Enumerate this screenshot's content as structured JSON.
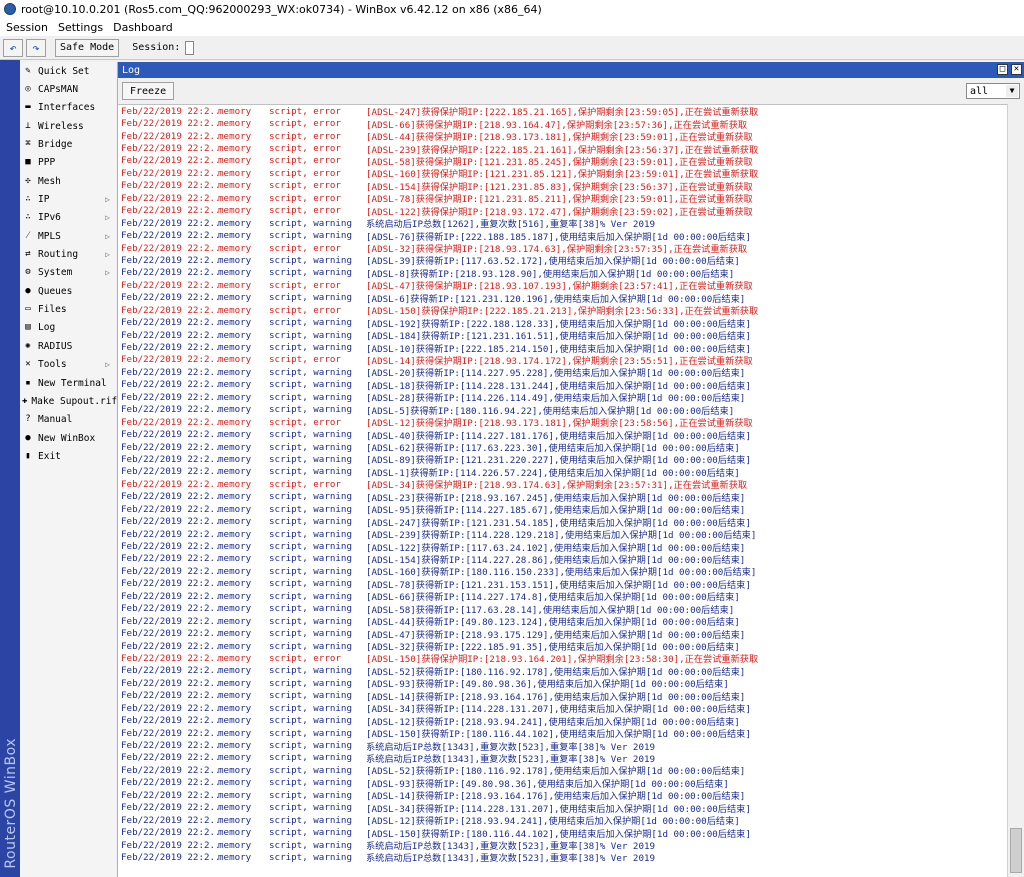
{
  "window": {
    "title": "root@10.10.0.201 (Ros5.com_QQ:962000293_WX:ok0734) - WinBox v6.42.12 on x86 (x86_64)"
  },
  "menu": [
    "Session",
    "Settings",
    "Dashboard"
  ],
  "toolbar": {
    "undo": "↶",
    "redo": "↷",
    "safe_mode": "Safe Mode",
    "session_label": "Session:"
  },
  "brand": "RouterOS WinBox",
  "sidebar": [
    {
      "label": "Quick Set",
      "icon": "quick-set-icon",
      "glyph": "✎",
      "arrow": false
    },
    {
      "label": "CAPsMAN",
      "icon": "capsman-icon",
      "glyph": "◎",
      "arrow": false
    },
    {
      "label": "Interfaces",
      "icon": "interfaces-icon",
      "glyph": "▬",
      "arrow": false
    },
    {
      "label": "Wireless",
      "icon": "wireless-icon",
      "glyph": "⊥",
      "arrow": false
    },
    {
      "label": "Bridge",
      "icon": "bridge-icon",
      "glyph": "⌘",
      "arrow": false
    },
    {
      "label": "PPP",
      "icon": "ppp-icon",
      "glyph": "■",
      "arrow": false
    },
    {
      "label": "Mesh",
      "icon": "mesh-icon",
      "glyph": "✣",
      "arrow": false
    },
    {
      "label": "IP",
      "icon": "ip-icon",
      "glyph": "∴",
      "arrow": true
    },
    {
      "label": "IPv6",
      "icon": "ipv6-icon",
      "glyph": "∴",
      "arrow": true
    },
    {
      "label": "MPLS",
      "icon": "mpls-icon",
      "glyph": "⁄",
      "arrow": true
    },
    {
      "label": "Routing",
      "icon": "routing-icon",
      "glyph": "⇄",
      "arrow": true
    },
    {
      "label": "System",
      "icon": "system-icon",
      "glyph": "⚙",
      "arrow": true
    },
    {
      "label": "Queues",
      "icon": "queues-icon",
      "glyph": "●",
      "arrow": false
    },
    {
      "label": "Files",
      "icon": "files-icon",
      "glyph": "▭",
      "arrow": false
    },
    {
      "label": "Log",
      "icon": "log-icon",
      "glyph": "▤",
      "arrow": false
    },
    {
      "label": "RADIUS",
      "icon": "radius-icon",
      "glyph": "✺",
      "arrow": false
    },
    {
      "label": "Tools",
      "icon": "tools-icon",
      "glyph": "✕",
      "arrow": true
    },
    {
      "label": "New Terminal",
      "icon": "terminal-icon",
      "glyph": "▪",
      "arrow": false
    },
    {
      "label": "Make Supout.rif",
      "icon": "supout-icon",
      "glyph": "✚",
      "arrow": false
    },
    {
      "label": "Manual",
      "icon": "manual-icon",
      "glyph": "?",
      "arrow": false
    },
    {
      "label": "New WinBox",
      "icon": "winbox-icon",
      "glyph": "●",
      "arrow": false
    },
    {
      "label": "Exit",
      "icon": "exit-icon",
      "glyph": "▮",
      "arrow": false
    }
  ],
  "log_window": {
    "title": "Log",
    "freeze_label": "Freeze",
    "filter_value": "all",
    "restore_btn": "□",
    "close_btn": "✕"
  },
  "log": [
    {
      "time": "Feb/22/2019 22:2...",
      "buffer": "memory",
      "topics": "script, error",
      "message": "[ADSL-247]获得保护期IP:[222.185.21.165],保护期剩余[23:59:05],正在尝试重新获取"
    },
    {
      "time": "Feb/22/2019 22:2...",
      "buffer": "memory",
      "topics": "script, error",
      "message": "[ADSL-66]获得保护期IP:[218.93.164.47],保护期剩余[23:57:36],正在尝试重新获取"
    },
    {
      "time": "Feb/22/2019 22:2...",
      "buffer": "memory",
      "topics": "script, error",
      "message": "[ADSL-44]获得保护期IP:[218.93.173.181],保护期剩余[23:59:01],正在尝试重新获取"
    },
    {
      "time": "Feb/22/2019 22:2...",
      "buffer": "memory",
      "topics": "script, error",
      "message": "[ADSL-239]获得保护期IP:[222.185.21.161],保护期剩余[23:56:37],正在尝试重新获取"
    },
    {
      "time": "Feb/22/2019 22:2...",
      "buffer": "memory",
      "topics": "script, error",
      "message": "[ADSL-58]获得保护期IP:[121.231.85.245],保护期剩余[23:59:01],正在尝试重新获取"
    },
    {
      "time": "Feb/22/2019 22:2...",
      "buffer": "memory",
      "topics": "script, error",
      "message": "[ADSL-160]获得保护期IP:[121.231.85.121],保护期剩余[23:59:01],正在尝试重新获取"
    },
    {
      "time": "Feb/22/2019 22:2...",
      "buffer": "memory",
      "topics": "script, error",
      "message": "[ADSL-154]获得保护期IP:[121.231.85.83],保护期剩余[23:56:37],正在尝试重新获取"
    },
    {
      "time": "Feb/22/2019 22:2...",
      "buffer": "memory",
      "topics": "script, error",
      "message": "[ADSL-78]获得保护期IP:[121.231.85.211],保护期剩余[23:59:01],正在尝试重新获取"
    },
    {
      "time": "Feb/22/2019 22:2...",
      "buffer": "memory",
      "topics": "script, error",
      "message": "[ADSL-122]获得保护期IP:[218.93.172.47],保护期剩余[23:59:02],正在尝试重新获取"
    },
    {
      "time": "Feb/22/2019 22:2...",
      "buffer": "memory",
      "topics": "script, warning",
      "message": "系统启动后IP总数[1262],重复次数[516],重复率[38]% Ver 2019"
    },
    {
      "time": "Feb/22/2019 22:2...",
      "buffer": "memory",
      "topics": "script, warning",
      "message": "[ADSL-76]获得新IP:[222.188.185.187],使用结束后加入保护期[1d 00:00:00后结束]"
    },
    {
      "time": "Feb/22/2019 22:2...",
      "buffer": "memory",
      "topics": "script, error",
      "message": "[ADSL-32]获得保护期IP:[218.93.174.63],保护期剩余[23:57:35],正在尝试重新获取"
    },
    {
      "time": "Feb/22/2019 22:2...",
      "buffer": "memory",
      "topics": "script, warning",
      "message": "[ADSL-39]获得新IP:[117.63.52.172],使用结束后加入保护期[1d 00:00:00后结束]"
    },
    {
      "time": "Feb/22/2019 22:2...",
      "buffer": "memory",
      "topics": "script, warning",
      "message": "[ADSL-8]获得新IP:[218.93.128.90],使用结束后加入保护期[1d 00:00:00后结束]"
    },
    {
      "time": "Feb/22/2019 22:2...",
      "buffer": "memory",
      "topics": "script, error",
      "message": "[ADSL-47]获得保护期IP:[218.93.107.193],保护期剩余[23:57:41],正在尝试重新获取"
    },
    {
      "time": "Feb/22/2019 22:2...",
      "buffer": "memory",
      "topics": "script, warning",
      "message": "[ADSL-6]获得新IP:[121.231.120.196],使用结束后加入保护期[1d 00:00:00后结束]"
    },
    {
      "time": "Feb/22/2019 22:2...",
      "buffer": "memory",
      "topics": "script, error",
      "message": "[ADSL-150]获得保护期IP:[222.185.21.213],保护期剩余[23:56:33],正在尝试重新获取"
    },
    {
      "time": "Feb/22/2019 22:2...",
      "buffer": "memory",
      "topics": "script, warning",
      "message": "[ADSL-192]获得新IP:[222.188.128.33],使用结束后加入保护期[1d 00:00:00后结束]"
    },
    {
      "time": "Feb/22/2019 22:2...",
      "buffer": "memory",
      "topics": "script, warning",
      "message": "[ADSL-184]获得新IP:[121.231.161.51],使用结束后加入保护期[1d 00:00:00后结束]"
    },
    {
      "time": "Feb/22/2019 22:2...",
      "buffer": "memory",
      "topics": "script, warning",
      "message": "[ADSL-10]获得新IP:[222.185.214.150],使用结束后加入保护期[1d 00:00:00后结束]"
    },
    {
      "time": "Feb/22/2019 22:2...",
      "buffer": "memory",
      "topics": "script, error",
      "message": "[ADSL-14]获得保护期IP:[218.93.174.172],保护期剩余[23:55:51],正在尝试重新获取"
    },
    {
      "time": "Feb/22/2019 22:2...",
      "buffer": "memory",
      "topics": "script, warning",
      "message": "[ADSL-20]获得新IP:[114.227.95.228],使用结束后加入保护期[1d 00:00:00后结束]"
    },
    {
      "time": "Feb/22/2019 22:2...",
      "buffer": "memory",
      "topics": "script, warning",
      "message": "[ADSL-18]获得新IP:[114.228.131.244],使用结束后加入保护期[1d 00:00:00后结束]"
    },
    {
      "time": "Feb/22/2019 22:2...",
      "buffer": "memory",
      "topics": "script, warning",
      "message": "[ADSL-28]获得新IP:[114.226.114.49],使用结束后加入保护期[1d 00:00:00后结束]"
    },
    {
      "time": "Feb/22/2019 22:2...",
      "buffer": "memory",
      "topics": "script, warning",
      "message": "[ADSL-5]获得新IP:[180.116.94.22],使用结束后加入保护期[1d 00:00:00后结束]"
    },
    {
      "time": "Feb/22/2019 22:2...",
      "buffer": "memory",
      "topics": "script, error",
      "message": "[ADSL-12]获得保护期IP:[218.93.173.181],保护期剩余[23:58:56],正在尝试重新获取"
    },
    {
      "time": "Feb/22/2019 22:2...",
      "buffer": "memory",
      "topics": "script, warning",
      "message": "[ADSL-40]获得新IP:[114.227.181.176],使用结束后加入保护期[1d 00:00:00后结束]"
    },
    {
      "time": "Feb/22/2019 22:2...",
      "buffer": "memory",
      "topics": "script, warning",
      "message": "[ADSL-62]获得新IP:[117.63.223.30],使用结束后加入保护期[1d 00:00:00后结束]"
    },
    {
      "time": "Feb/22/2019 22:2...",
      "buffer": "memory",
      "topics": "script, warning",
      "message": "[ADSL-89]获得新IP:[121.231.220.227],使用结束后加入保护期[1d 00:00:00后结束]"
    },
    {
      "time": "Feb/22/2019 22:2...",
      "buffer": "memory",
      "topics": "script, warning",
      "message": "[ADSL-1]获得新IP:[114.226.57.224],使用结束后加入保护期[1d 00:00:00后结束]"
    },
    {
      "time": "Feb/22/2019 22:2...",
      "buffer": "memory",
      "topics": "script, error",
      "message": "[ADSL-34]获得保护期IP:[218.93.174.63],保护期剩余[23:57:31],正在尝试重新获取"
    },
    {
      "time": "Feb/22/2019 22:2...",
      "buffer": "memory",
      "topics": "script, warning",
      "message": "[ADSL-23]获得新IP:[218.93.167.245],使用结束后加入保护期[1d 00:00:00后结束]"
    },
    {
      "time": "Feb/22/2019 22:2...",
      "buffer": "memory",
      "topics": "script, warning",
      "message": "[ADSL-95]获得新IP:[114.227.185.67],使用结束后加入保护期[1d 00:00:00后结束]"
    },
    {
      "time": "Feb/22/2019 22:2...",
      "buffer": "memory",
      "topics": "script, warning",
      "message": "[ADSL-247]获得新IP:[121.231.54.185],使用结束后加入保护期[1d 00:00:00后结束]"
    },
    {
      "time": "Feb/22/2019 22:2...",
      "buffer": "memory",
      "topics": "script, warning",
      "message": "[ADSL-239]获得新IP:[114.228.129.218],使用结束后加入保护期[1d 00:00:00后结束]"
    },
    {
      "time": "Feb/22/2019 22:2...",
      "buffer": "memory",
      "topics": "script, warning",
      "message": "[ADSL-122]获得新IP:[117.63.24.102],使用结束后加入保护期[1d 00:00:00后结束]"
    },
    {
      "time": "Feb/22/2019 22:2...",
      "buffer": "memory",
      "topics": "script, warning",
      "message": "[ADSL-154]获得新IP:[114.227.28.86],使用结束后加入保护期[1d 00:00:00后结束]"
    },
    {
      "time": "Feb/22/2019 22:2...",
      "buffer": "memory",
      "topics": "script, warning",
      "message": "[ADSL-160]获得新IP:[180.116.150.233],使用结束后加入保护期[1d 00:00:00后结束]"
    },
    {
      "time": "Feb/22/2019 22:2...",
      "buffer": "memory",
      "topics": "script, warning",
      "message": "[ADSL-78]获得新IP:[121.231.153.151],使用结束后加入保护期[1d 00:00:00后结束]"
    },
    {
      "time": "Feb/22/2019 22:2...",
      "buffer": "memory",
      "topics": "script, warning",
      "message": "[ADSL-66]获得新IP:[114.227.174.8],使用结束后加入保护期[1d 00:00:00后结束]"
    },
    {
      "time": "Feb/22/2019 22:2...",
      "buffer": "memory",
      "topics": "script, warning",
      "message": "[ADSL-58]获得新IP:[117.63.28.14],使用结束后加入保护期[1d 00:00:00后结束]"
    },
    {
      "time": "Feb/22/2019 22:2...",
      "buffer": "memory",
      "topics": "script, warning",
      "message": "[ADSL-44]获得新IP:[49.80.123.124],使用结束后加入保护期[1d 00:00:00后结束]"
    },
    {
      "time": "Feb/22/2019 22:2...",
      "buffer": "memory",
      "topics": "script, warning",
      "message": "[ADSL-47]获得新IP:[218.93.175.129],使用结束后加入保护期[1d 00:00:00后结束]"
    },
    {
      "time": "Feb/22/2019 22:2...",
      "buffer": "memory",
      "topics": "script, warning",
      "message": "[ADSL-32]获得新IP:[222.185.91.35],使用结束后加入保护期[1d 00:00:00后结束]"
    },
    {
      "time": "Feb/22/2019 22:2...",
      "buffer": "memory",
      "topics": "script, error",
      "message": "[ADSL-150]获得保护期IP:[218.93.164.201],保护期剩余[23:58:30],正在尝试重新获取"
    },
    {
      "time": "Feb/22/2019 22:2...",
      "buffer": "memory",
      "topics": "script, warning",
      "message": "[ADSL-52]获得新IP:[180.116.92.178],使用结束后加入保护期[1d 00:00:00后结束]"
    },
    {
      "time": "Feb/22/2019 22:2...",
      "buffer": "memory",
      "topics": "script, warning",
      "message": "[ADSL-93]获得新IP:[49.80.98.36],使用结束后加入保护期[1d 00:00:00后结束]"
    },
    {
      "time": "Feb/22/2019 22:2...",
      "buffer": "memory",
      "topics": "script, warning",
      "message": "[ADSL-14]获得新IP:[218.93.164.176],使用结束后加入保护期[1d 00:00:00后结束]"
    },
    {
      "time": "Feb/22/2019 22:2...",
      "buffer": "memory",
      "topics": "script, warning",
      "message": "[ADSL-34]获得新IP:[114.228.131.207],使用结束后加入保护期[1d 00:00:00后结束]"
    },
    {
      "time": "Feb/22/2019 22:2...",
      "buffer": "memory",
      "topics": "script, warning",
      "message": "[ADSL-12]获得新IP:[218.93.94.241],使用结束后加入保护期[1d 00:00:00后结束]"
    },
    {
      "time": "Feb/22/2019 22:2...",
      "buffer": "memory",
      "topics": "script, warning",
      "message": "[ADSL-150]获得新IP:[180.116.44.102],使用结束后加入保护期[1d 00:00:00后结束]"
    },
    {
      "time": "Feb/22/2019 22:2...",
      "buffer": "memory",
      "topics": "script, warning",
      "message": "系统启动后IP总数[1343],重复次数[523],重复率[38]% Ver 2019"
    },
    {
      "time": "Feb/22/2019 22:2...",
      "buffer": "memory",
      "topics": "script, warning",
      "message": "系统启动后IP总数[1343],重复次数[523],重复率[38]% Ver 2019"
    },
    {
      "time": "Feb/22/2019 22:2...",
      "buffer": "memory",
      "topics": "script, warning",
      "message": "[ADSL-52]获得新IP:[180.116.92.178],使用结束后加入保护期[1d 00:00:00后结束]"
    },
    {
      "time": "Feb/22/2019 22:2...",
      "buffer": "memory",
      "topics": "script, warning",
      "message": "[ADSL-93]获得新IP:[49.80.98.36],使用结束后加入保护期[1d 00:00:00后结束]"
    },
    {
      "time": "Feb/22/2019 22:2...",
      "buffer": "memory",
      "topics": "script, warning",
      "message": "[ADSL-14]获得新IP:[218.93.164.176],使用结束后加入保护期[1d 00:00:00后结束]"
    },
    {
      "time": "Feb/22/2019 22:2...",
      "buffer": "memory",
      "topics": "script, warning",
      "message": "[ADSL-34]获得新IP:[114.228.131.207],使用结束后加入保护期[1d 00:00:00后结束]"
    },
    {
      "time": "Feb/22/2019 22:2...",
      "buffer": "memory",
      "topics": "script, warning",
      "message": "[ADSL-12]获得新IP:[218.93.94.241],使用结束后加入保护期[1d 00:00:00后结束]"
    },
    {
      "time": "Feb/22/2019 22:2...",
      "buffer": "memory",
      "topics": "script, warning",
      "message": "[ADSL-150]获得新IP:[180.116.44.102],使用结束后加入保护期[1d 00:00:00后结束]"
    },
    {
      "time": "Feb/22/2019 22:2...",
      "buffer": "memory",
      "topics": "script, warning",
      "message": "系统启动后IP总数[1343],重复次数[523],重复率[38]% Ver 2019"
    },
    {
      "time": "Feb/22/2019 22:2...",
      "buffer": "memory",
      "topics": "script, warning",
      "message": "系统启动后IP总数[1343],重复次数[523],重复率[38]% Ver 2019"
    }
  ],
  "colors": {
    "error": "#d8201c",
    "warning": "#1c2c8c",
    "titlebar": "#2d5ab8",
    "brand": "#2c45a5"
  }
}
